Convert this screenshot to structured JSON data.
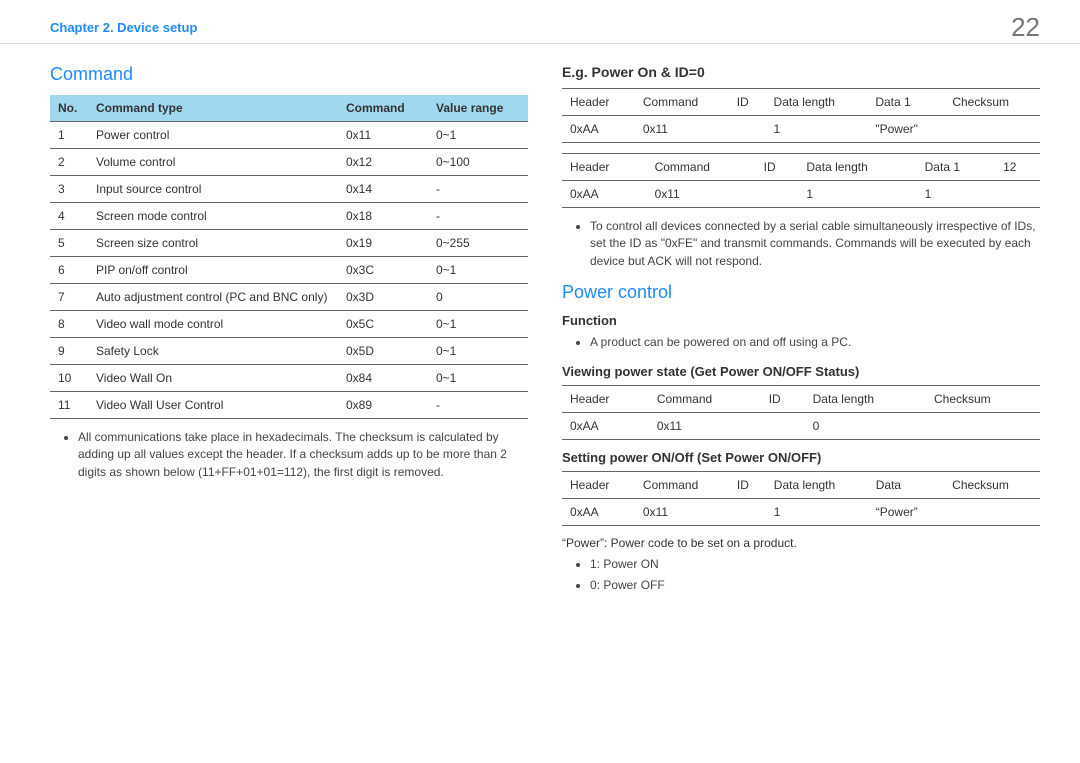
{
  "header": {
    "chapter": "Chapter 2. Device setup",
    "page": "22"
  },
  "left": {
    "title": "Command",
    "table_headers": [
      "No.",
      "Command type",
      "Command",
      "Value range"
    ],
    "rows": [
      {
        "no": "1",
        "type": "Power control",
        "cmd": "0x11",
        "range": "0~1"
      },
      {
        "no": "2",
        "type": "Volume control",
        "cmd": "0x12",
        "range": "0~100"
      },
      {
        "no": "3",
        "type": "Input source control",
        "cmd": "0x14",
        "range": "-"
      },
      {
        "no": "4",
        "type": "Screen mode control",
        "cmd": "0x18",
        "range": "-"
      },
      {
        "no": "5",
        "type": "Screen size control",
        "cmd": "0x19",
        "range": "0~255"
      },
      {
        "no": "6",
        "type": "PIP on/off control",
        "cmd": "0x3C",
        "range": "0~1"
      },
      {
        "no": "7",
        "type": "Auto adjustment control (PC and BNC only)",
        "cmd": "0x3D",
        "range": "0"
      },
      {
        "no": "8",
        "type": "Video wall mode control",
        "cmd": "0x5C",
        "range": "0~1"
      },
      {
        "no": "9",
        "type": "Safety Lock",
        "cmd": "0x5D",
        "range": "0~1"
      },
      {
        "no": "10",
        "type": "Video Wall On",
        "cmd": "0x84",
        "range": "0~1"
      },
      {
        "no": "11",
        "type": "Video Wall User Control",
        "cmd": "0x89",
        "range": "-"
      }
    ],
    "note": "All communications take place in hexadecimals. The checksum is calculated by adding up all values except the header. If a checksum adds up to be more than 2 digits as shown below (11+FF+01+01=112), the first digit is removed."
  },
  "right": {
    "eg_title": "E.g. Power On & ID=0",
    "t1_headers": [
      "Header",
      "Command",
      "ID",
      "Data length",
      "Data 1",
      "Checksum"
    ],
    "t1_row": [
      "0xAA",
      "0x11",
      "",
      "1",
      "\"Power\"",
      ""
    ],
    "t2_headers": [
      "Header",
      "Command",
      "ID",
      "Data length",
      "Data 1",
      "12"
    ],
    "t2_row": [
      "0xAA",
      "0x11",
      "",
      "1",
      "1",
      ""
    ],
    "eg_note": "To control all devices connected by a serial cable simultaneously irrespective of IDs, set the ID as \"0xFE\" and transmit commands. Commands will be executed by each device but ACK will not respond.",
    "pc_title": "Power control",
    "func_label": "Function",
    "func_note": "A product can be powered on and off using a PC.",
    "view_title": "Viewing power state (Get Power ON/OFF Status)",
    "t3_headers": [
      "Header",
      "Command",
      "ID",
      "Data length",
      "Checksum"
    ],
    "t3_row": [
      "0xAA",
      "0x11",
      "",
      "0",
      ""
    ],
    "set_title": "Setting power ON/Off (Set Power ON/OFF)",
    "t4_headers": [
      "Header",
      "Command",
      "ID",
      "Data length",
      "Data",
      "Checksum"
    ],
    "t4_row": [
      "0xAA",
      "0x11",
      "",
      "1",
      "“Power”",
      ""
    ],
    "power_note": "“Power”: Power code to be set on a product.",
    "power_on": "1: Power ON",
    "power_off": "0: Power OFF"
  }
}
